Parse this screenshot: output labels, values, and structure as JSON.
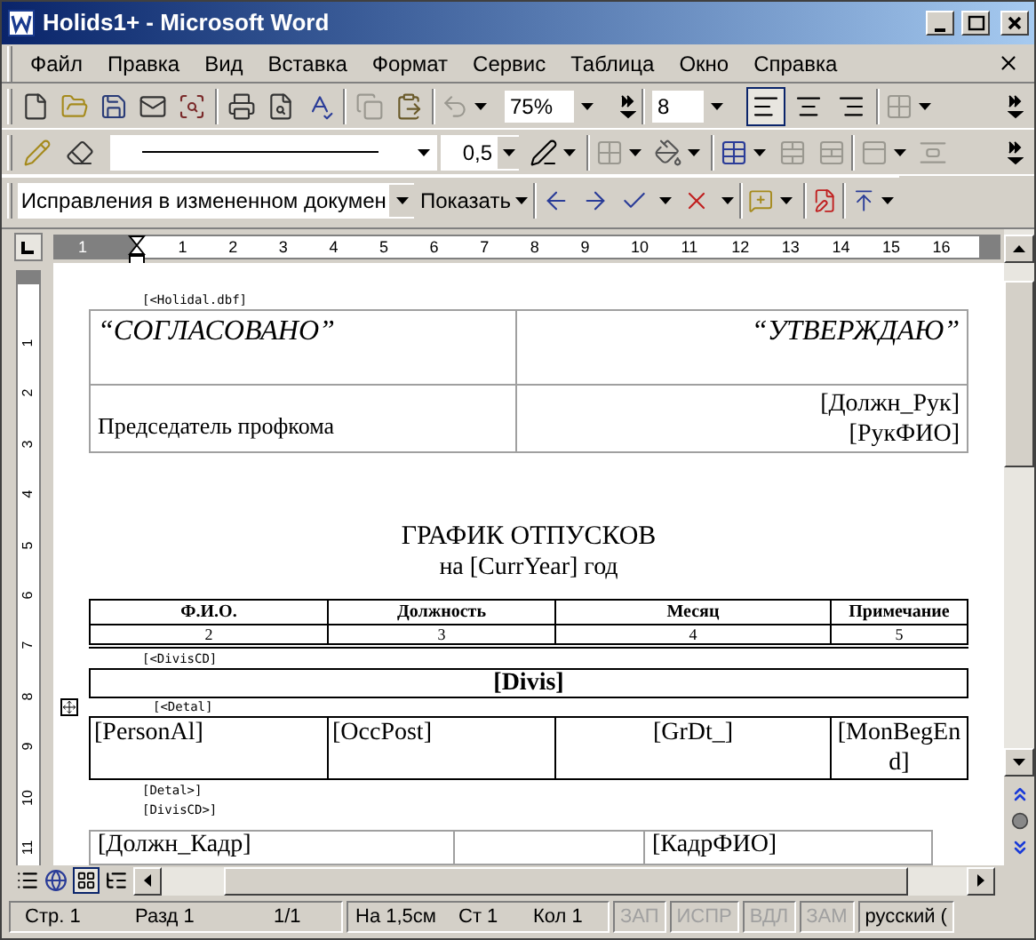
{
  "window": {
    "title": "Holids1+ - Microsoft Word"
  },
  "menu": [
    "Файл",
    "Правка",
    "Вид",
    "Вставка",
    "Формат",
    "Сервис",
    "Таблица",
    "Окно",
    "Справка"
  ],
  "standard_toolbar": {
    "zoom": "75%",
    "font_size": "8",
    "alignment": [
      {
        "kind": "left",
        "selected": true
      },
      {
        "kind": "center",
        "selected": false
      },
      {
        "kind": "right",
        "selected": false
      }
    ]
  },
  "tables_toolbar": {
    "line_weight": "0,5"
  },
  "reviewing_toolbar": {
    "display": "Исправления в измененном докумен",
    "show": "Показать"
  },
  "ruler": {
    "horizontal": [
      "1",
      "1",
      "2",
      "3",
      "4",
      "5",
      "6",
      "7",
      "8",
      "9",
      "10",
      "11",
      "12",
      "13",
      "14",
      "15",
      "16"
    ],
    "vertical": [
      "1",
      "2",
      "3",
      "4",
      "5",
      "6",
      "7",
      "8",
      "9",
      "10",
      "11"
    ]
  },
  "document": {
    "source_tag": "[<Holidal.dbf]",
    "approval": {
      "left_heading": "“СОГЛАСОВАНО”",
      "right_heading": "“УТВЕРЖДАЮ”",
      "left_signer": "Председатель профкома",
      "right_signer": [
        "[Должн_Рук]",
        "[РукФИО]"
      ]
    },
    "title": "ГРАФИК ОТПУСКОВ",
    "subtitle": "на [CurrYear] год",
    "columns": [
      "Ф.И.О.",
      "Должность",
      "Месяц",
      "Примечание"
    ],
    "column_numbers": [
      "2",
      "3",
      "4",
      "5"
    ],
    "group_start_tag": "[<DivisCD]",
    "group_row": "[Divis]",
    "detail_start_tag": "[<Detal]",
    "detail_row": [
      "[PersonAl]",
      "[OccPost]",
      "[GrDt_]",
      "[MonBegEnd]"
    ],
    "detail_end_tag": "[Detal>]",
    "group_end_tag": "[DivisCD>]",
    "footer_row": {
      "column_1": "[Должн_Кадр]",
      "column_3": "[КадрФИО]"
    }
  },
  "status_bar": {
    "items": [
      "Стр. 1",
      "Разд 1",
      "1/1",
      "На 1,5см",
      "Ст 1",
      "Кол 1"
    ],
    "modes": [
      {
        "label": "ЗАП",
        "enabled": false
      },
      {
        "label": "ИСПР",
        "enabled": false
      },
      {
        "label": "ВДЛ",
        "enabled": false
      },
      {
        "label": "ЗАМ",
        "enabled": false
      }
    ],
    "language": "русский ("
  }
}
